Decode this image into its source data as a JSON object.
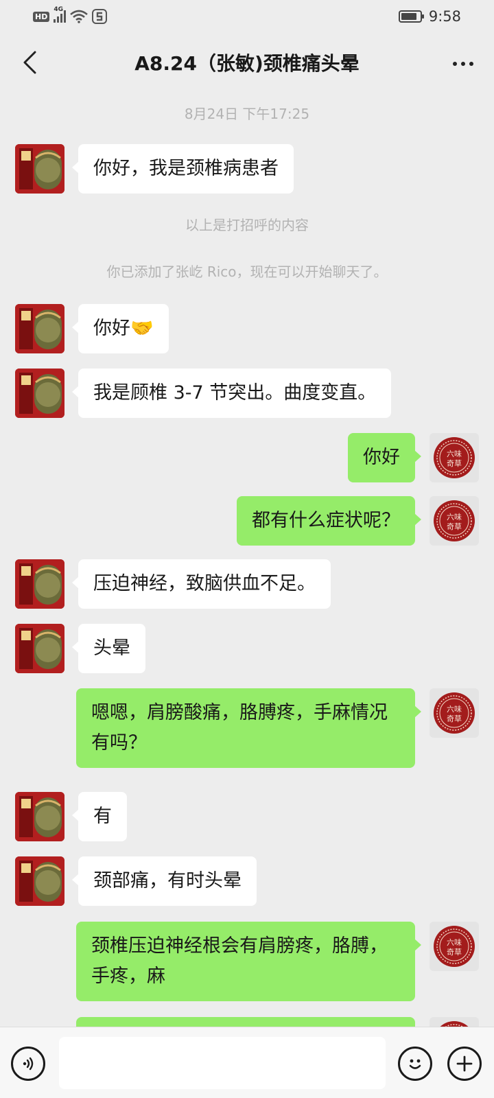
{
  "status_bar": {
    "network_badge": "HD",
    "network_type": "4G",
    "time": "9:58",
    "battery_level": 0.85
  },
  "header": {
    "title": "A8.24（张敏)颈椎痛头晕"
  },
  "chat": {
    "timestamp": "8月24日 下午17:25",
    "system_greeting_note": "以上是打招呼的内容",
    "system_added_note": "你已添加了张屹 Rico，现在可以开始聊天了。",
    "self_avatar_text": "六味奇草",
    "messages": [
      {
        "from": "contact",
        "text": "你好，我是颈椎病患者"
      },
      {
        "from": "contact",
        "text": "你好🤝"
      },
      {
        "from": "contact",
        "text": "我是顾椎 3-7 节突出。曲度变直。"
      },
      {
        "from": "self",
        "text": "你好"
      },
      {
        "from": "self",
        "text": "都有什么症状呢？"
      },
      {
        "from": "contact",
        "text": "压迫神经，致脑供血不足。"
      },
      {
        "from": "contact",
        "text": "头晕"
      },
      {
        "from": "self",
        "text": "嗯嗯，肩膀酸痛，胳膊疼，手麻情况有吗？"
      },
      {
        "from": "contact",
        "text": "有"
      },
      {
        "from": "contact",
        "text": "颈部痛，有时头晕"
      },
      {
        "from": "self",
        "text": "颈椎压迫神经根会有肩膀疼，胳膊，手疼，麻"
      }
    ]
  },
  "input_bar": {
    "placeholder": ""
  },
  "colors": {
    "background": "#ededed",
    "bubble_self": "#95ec69",
    "bubble_contact": "#ffffff",
    "avatar_contact": "#b21f1f",
    "avatar_self_seal": "#a31c1c"
  }
}
